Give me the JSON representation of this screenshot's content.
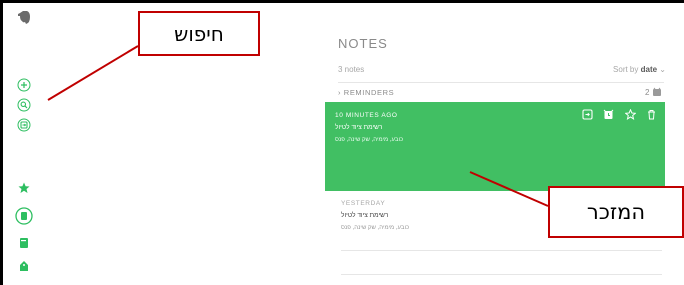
{
  "sidebar": {
    "icons": [
      "evernote-logo-icon",
      "new-note-plus-icon",
      "search-icon",
      "work-chat-icon",
      "shortcuts-star-icon",
      "notes-icon",
      "notebooks-icon",
      "tags-icon"
    ]
  },
  "notes_panel": {
    "title": "NOTES",
    "note_count": "3 notes",
    "sort_prefix": "Sort by",
    "sort_value": "date",
    "reminders_label": "REMINDERS",
    "reminders_count": "2",
    "notes": [
      {
        "time": "10 MINUTES AGO",
        "title": "רשימת ציוד לטיול",
        "snippet": "כובע, מימיה, שק שינה, פנס",
        "selected": true
      },
      {
        "time": "YESTERDAY",
        "title": "רשימת ציוד לטיול",
        "snippet": "כובע, מימיה, שק שינה, פנס",
        "selected": false
      }
    ]
  },
  "annotations": {
    "search_label": "חיפוש",
    "note_label": "המזכר"
  },
  "colors": {
    "accent": "#2dbe60",
    "selected_note": "#41bf63",
    "callout_border": "#c00000"
  }
}
